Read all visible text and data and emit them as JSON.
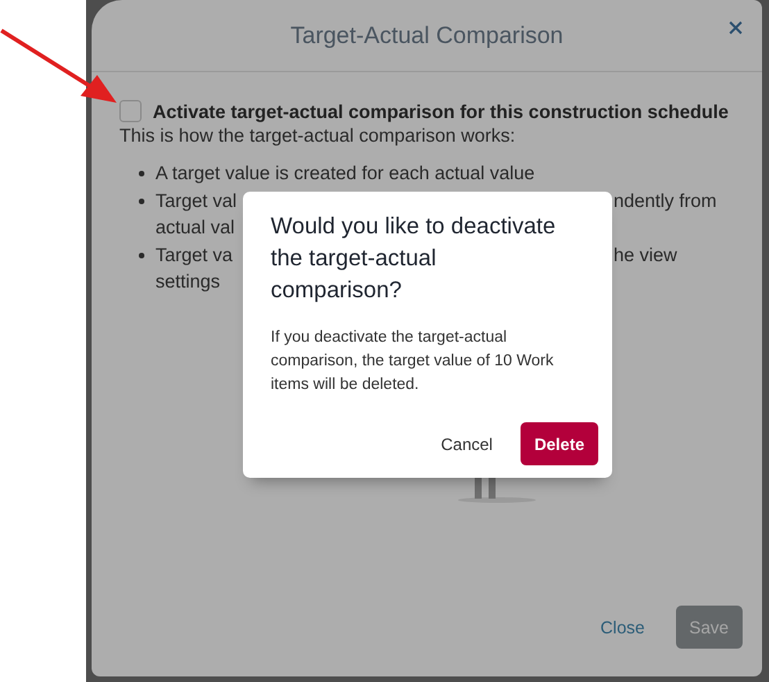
{
  "window": {
    "title": "Target-Actual Comparison"
  },
  "activation": {
    "label": "Activate target-actual comparison for this construction schedule",
    "checked": false
  },
  "intro": "This is how the target-actual comparison works:",
  "bullets": [
    {
      "lines": [
        {
          "left": "A target value is created for each actual value"
        }
      ]
    },
    {
      "lines": [
        {
          "left": "Target val",
          "right": "ndently from"
        },
        {
          "left": "actual val"
        }
      ]
    },
    {
      "lines": [
        {
          "left": "Target va",
          "right": "he view"
        },
        {
          "left": "settings"
        }
      ]
    }
  ],
  "footer": {
    "buttons": [
      {
        "label": "Close",
        "kind": "link",
        "disabled": false
      },
      {
        "label": "Save",
        "kind": "primary",
        "disabled": true
      }
    ]
  },
  "confirm": {
    "title": "Would you like to deactivate the target-actual comparison?",
    "message": "If you deactivate the target-actual comparison, the target value of 10 Work items will be deleted.",
    "buttons": [
      {
        "label": "Cancel",
        "kind": "text"
      },
      {
        "label": "Delete",
        "kind": "danger"
      }
    ]
  }
}
